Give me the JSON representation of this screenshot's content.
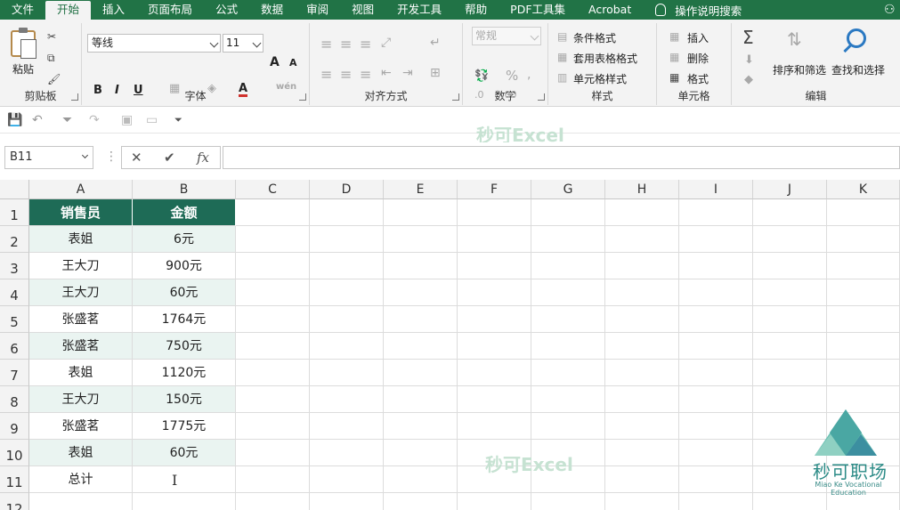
{
  "tabs": [
    "文件",
    "开始",
    "插入",
    "页面布局",
    "公式",
    "数据",
    "审阅",
    "视图",
    "开发工具",
    "帮助",
    "PDF工具集",
    "Acrobat"
  ],
  "active_tab": "开始",
  "tell_me": "操作说明搜索",
  "ribbon": {
    "clipboard": {
      "label": "剪贴板",
      "paste": "粘贴"
    },
    "font": {
      "label": "字体",
      "font_name": "等线",
      "font_size": "11",
      "bold": "B",
      "italic": "I",
      "underline": "U",
      "grow": "A",
      "shrink": "A",
      "phonetic": "wén"
    },
    "alignment": {
      "label": "对齐方式"
    },
    "number": {
      "label": "数字",
      "format": "常规",
      "percent": "%"
    },
    "styles": {
      "label": "样式",
      "conditional": "条件格式",
      "table_format": "套用表格格式",
      "cell_styles": "单元格样式"
    },
    "cells": {
      "label": "单元格",
      "insert": "插入",
      "delete": "删除",
      "format": "格式"
    },
    "editing": {
      "label": "编辑",
      "sum": "Σ",
      "sort_filter": "排序和筛选",
      "find_select": "查找和选择"
    }
  },
  "watermark": "秒可Excel",
  "formula_bar": {
    "name_box": "B11",
    "cancel": "✕",
    "enter": "✔",
    "fx": "fx",
    "value": ""
  },
  "columns": [
    "A",
    "B",
    "C",
    "D",
    "E",
    "F",
    "G",
    "H",
    "I",
    "J",
    "K"
  ],
  "rows": [
    "1",
    "2",
    "3",
    "4",
    "5",
    "6",
    "7",
    "8",
    "9",
    "10",
    "11",
    "12"
  ],
  "table": {
    "headers": [
      "销售员",
      "金额"
    ],
    "data": [
      [
        "表姐",
        "6元"
      ],
      [
        "王大刀",
        "900元"
      ],
      [
        "王大刀",
        "60元"
      ],
      [
        "张盛茗",
        "1764元"
      ],
      [
        "张盛茗",
        "750元"
      ],
      [
        "表姐",
        "1120元"
      ],
      [
        "王大刀",
        "150元"
      ],
      [
        "张盛茗",
        "1775元"
      ],
      [
        "表姐",
        "60元"
      ]
    ],
    "total_label": "总计",
    "total_value": ""
  },
  "logo": {
    "name": "秒可职场",
    "subtitle": "Miao Ke Vocational Education"
  }
}
